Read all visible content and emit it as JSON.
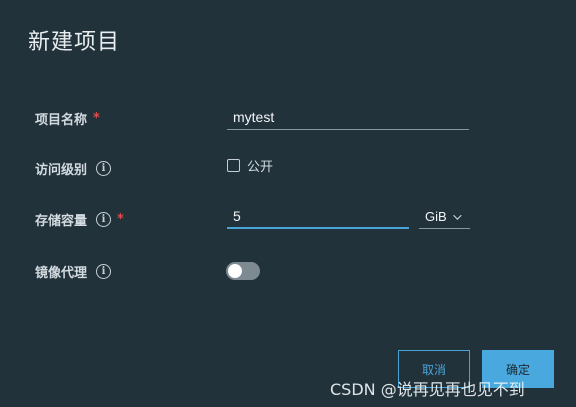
{
  "dialog": {
    "title": "新建项目"
  },
  "fields": {
    "project_name": {
      "label": "项目名称",
      "required_mark": "*",
      "value": "mytest"
    },
    "access_level": {
      "label": "访问级别",
      "info_icon": "i",
      "checkbox_label": "公开",
      "checked": false
    },
    "storage_capacity": {
      "label": "存储容量",
      "info_icon": "i",
      "required_mark": "*",
      "value": "5",
      "unit": "GiB"
    },
    "mirror_proxy": {
      "label": "镜像代理",
      "info_icon": "i",
      "enabled": false
    }
  },
  "buttons": {
    "cancel": "取消",
    "confirm": "确定"
  },
  "watermark": "CSDN @说再见再也见不到",
  "colors": {
    "accent": "#49a8dd",
    "required": "#e24b4b",
    "background": "#22323b"
  }
}
